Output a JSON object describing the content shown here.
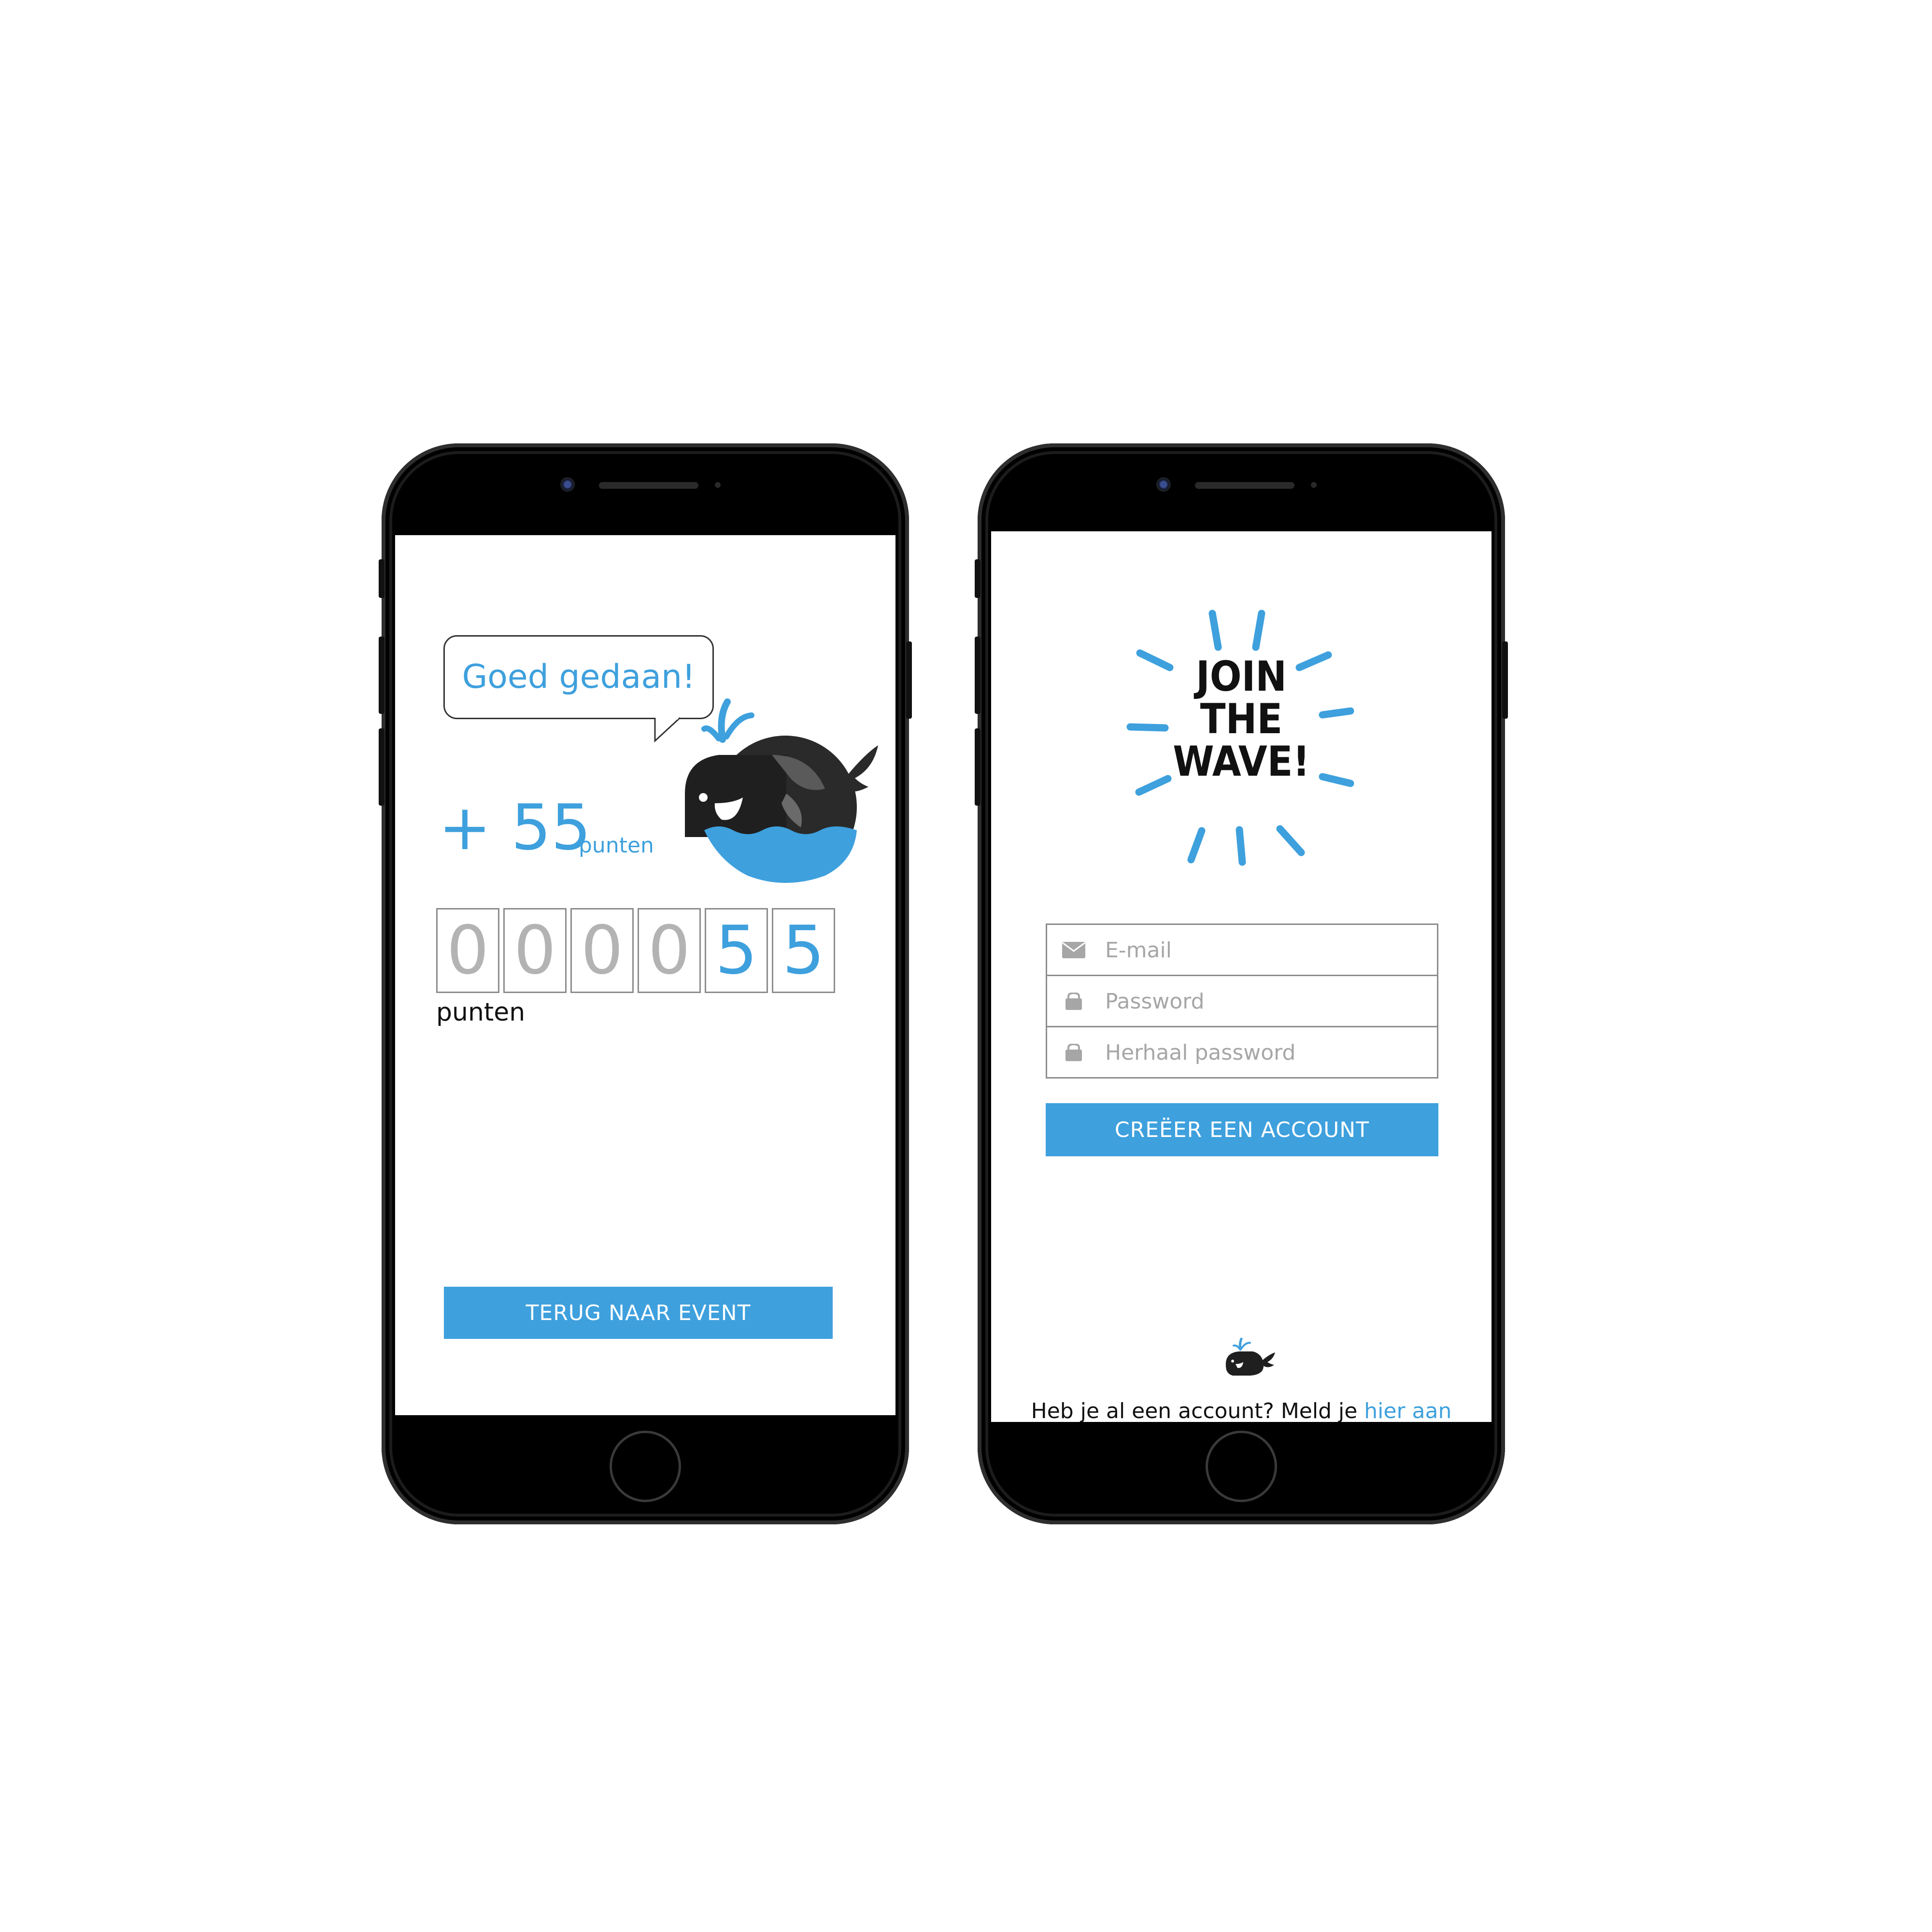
{
  "colors": {
    "accent": "#3ea0dd",
    "device": "#000000",
    "whale": "#2a2a2a"
  },
  "points_screen": {
    "bubble_text": "Goed gedaan!",
    "plus_points": "+ 55",
    "plus_unit": "punten",
    "total_digits": [
      "0",
      "0",
      "0",
      "0",
      "5",
      "5"
    ],
    "total_label": "punten",
    "back_button": "TERUG NAAR EVENT"
  },
  "signup_screen": {
    "logo_lines": [
      "JOIN",
      "THE",
      "WAVE!"
    ],
    "fields": [
      {
        "icon": "envelope-icon",
        "placeholder": "E-mail"
      },
      {
        "icon": "lock-icon",
        "placeholder": "Password"
      },
      {
        "icon": "lock-icon",
        "placeholder": "Herhaal password"
      }
    ],
    "create_button": "CREËER EEN ACCOUNT",
    "login_prompt": "Heb je al een account? Meld je",
    "login_link": "hier aan"
  }
}
